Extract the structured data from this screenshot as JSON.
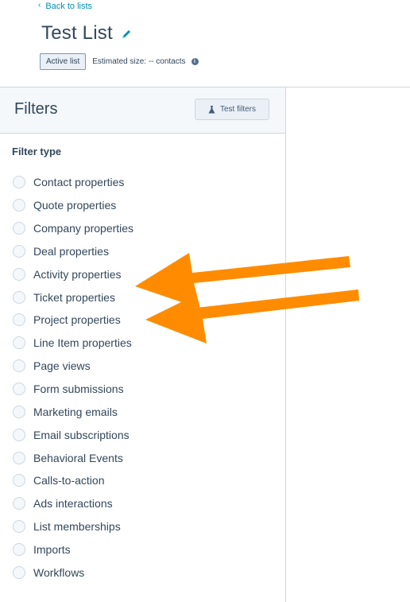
{
  "header": {
    "back_label": "Back to lists",
    "title": "Test List",
    "status_badge": "Active list",
    "estimated_size": "Estimated size: -- contacts"
  },
  "filters": {
    "title": "Filters",
    "test_button_label": "Test filters",
    "filter_type_label": "Filter type",
    "options": [
      "Contact properties",
      "Quote properties",
      "Company properties",
      "Deal properties",
      "Activity properties",
      "Ticket properties",
      "Project properties",
      "Line Item properties",
      "Page views",
      "Form submissions",
      "Marketing emails",
      "Email subscriptions",
      "Behavioral Events",
      "Calls-to-action",
      "Ads interactions",
      "List memberships",
      "Imports",
      "Workflows"
    ]
  },
  "colors": {
    "link": "#0091ae",
    "text": "#33475b",
    "annotation_arrow": "#ff8c00"
  },
  "icons": {
    "back": "chevron-left-icon",
    "edit": "pencil-icon",
    "info": "info-icon",
    "test": "flask-icon"
  }
}
